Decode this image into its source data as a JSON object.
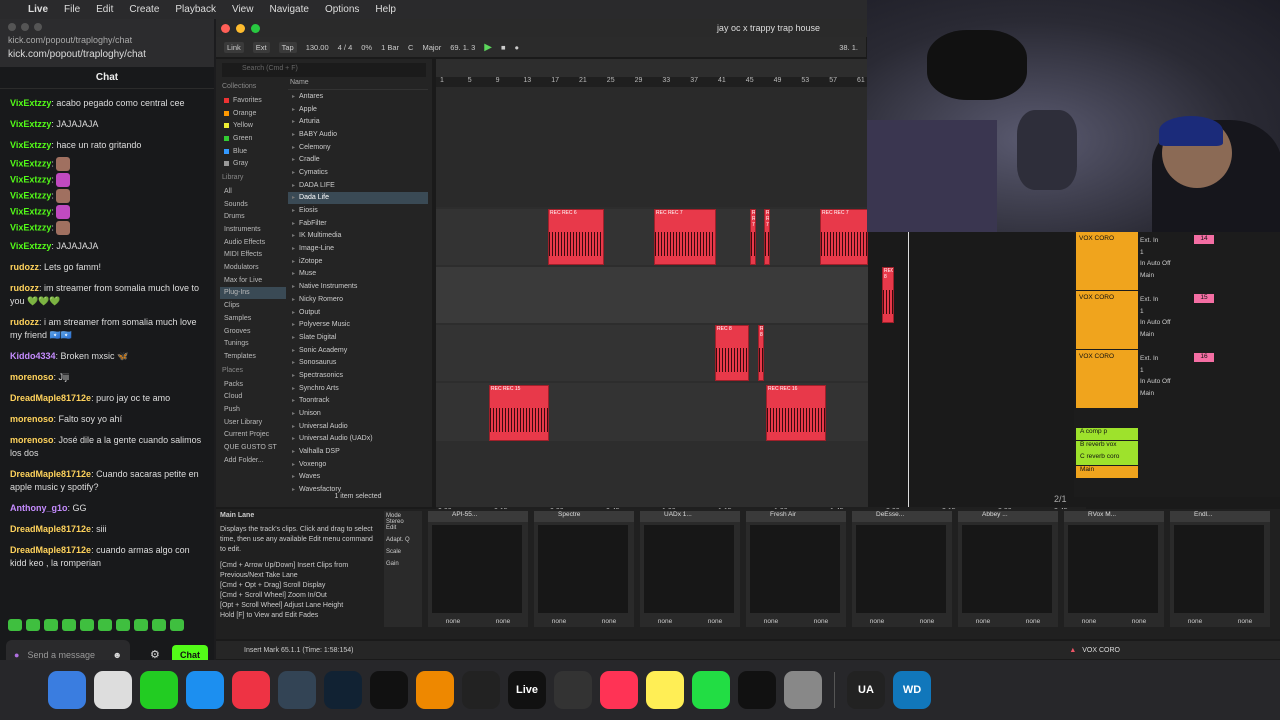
{
  "menubar": {
    "app": "Live",
    "items": [
      "File",
      "Edit",
      "Create",
      "Playback",
      "View",
      "Navigate",
      "Options",
      "Help"
    ]
  },
  "chat": {
    "tab": "kick.com/popout/traploghy/chat",
    "url": "kick.com/popout/traploghy/chat",
    "title": "Chat",
    "messages": [
      {
        "user": "VixExtzzy",
        "color": "#53fc18",
        "text": "acabo pegado como central cee"
      },
      {
        "user": "VixExtzzy",
        "color": "#53fc18",
        "text": "JAJAJAJA"
      },
      {
        "user": "VixExtzzy",
        "color": "#53fc18",
        "text": "hace un rato gritando"
      },
      {
        "user": "VixExtzzy",
        "color": "#53fc18",
        "text": "",
        "emote": "e"
      },
      {
        "user": "VixExtzzy",
        "color": "#53fc18",
        "text": "",
        "emote": "p"
      },
      {
        "user": "VixExtzzy",
        "color": "#53fc18",
        "text": "",
        "emote": "e"
      },
      {
        "user": "VixExtzzy",
        "color": "#53fc18",
        "text": "",
        "emote": "p"
      },
      {
        "user": "VixExtzzy",
        "color": "#53fc18",
        "text": "",
        "emote": "e"
      },
      {
        "user": "VixExtzzy",
        "color": "#53fc18",
        "text": "JAJAJAJA"
      },
      {
        "user": "rudozz",
        "color": "#ffd35c",
        "text": "Lets go famm!"
      },
      {
        "user": "rudozz",
        "color": "#ffd35c",
        "text": "im streamer from somalia much love to you 💚💚💚"
      },
      {
        "user": "rudozz",
        "color": "#ffd35c",
        "text": "i am streamer from somalia much love my friend 🇸🇴🇸🇴"
      },
      {
        "user": "Kiddo4334",
        "color": "#c58cff",
        "text": "Broken mxsic 🦋"
      },
      {
        "user": "morenoso",
        "color": "#ffd35c",
        "text": "Jiji"
      },
      {
        "user": "DreadMaple81712e",
        "color": "#ffd35c",
        "text": "puro jay oc te amo"
      },
      {
        "user": "morenoso",
        "color": "#ffd35c",
        "text": "Falto soy yo ahí"
      },
      {
        "user": "morenoso",
        "color": "#ffd35c",
        "text": "José dile a la gente cuando salimos los dos"
      },
      {
        "user": "DreadMaple81712e",
        "color": "#ffd35c",
        "text": "Cuando sacaras petite en apple music y spotify?"
      },
      {
        "user": "Anthony_g1o",
        "color": "#c58cff",
        "text": "GG"
      },
      {
        "user": "DreadMaple81712e",
        "color": "#ffd35c",
        "text": "siii"
      },
      {
        "user": "DreadMaple81712e",
        "color": "#ffd35c",
        "text": "cuando armas algo con kidd keo , la romperian"
      }
    ],
    "placeholder": "Send a message",
    "send": "Chat"
  },
  "live": {
    "title": "jay oc x trappy trap house",
    "transport": {
      "link": "Link",
      "ext": "Ext",
      "tap": "Tap",
      "bpm": "130.00",
      "sig": "4 / 4",
      "pct": "0%",
      "quant": "1 Bar",
      "key": "C",
      "scale": "Major",
      "pos": "69.  1.  3",
      "end": "38.  1."
    },
    "browser": {
      "search": "Search (Cmd + F)",
      "collections_header": "Collections",
      "collections": [
        {
          "label": "Favorites",
          "color": "#e33"
        },
        {
          "label": "Orange",
          "color": "#f90"
        },
        {
          "label": "Yellow",
          "color": "#ee3"
        },
        {
          "label": "Green",
          "color": "#3c3"
        },
        {
          "label": "Blue",
          "color": "#39f"
        },
        {
          "label": "Gray",
          "color": "#999"
        }
      ],
      "library_header": "Library",
      "library": [
        "All",
        "Sounds",
        "Drums",
        "Instruments",
        "Audio Effects",
        "MIDI Effects",
        "Modulators",
        "Max for Live",
        "Plug-Ins",
        "Clips",
        "Samples",
        "Grooves",
        "Tunings",
        "Templates"
      ],
      "places_header": "Places",
      "places": [
        "Packs",
        "Cloud",
        "Push",
        "User Library",
        "Current Projec",
        "QUE GUSTO ST",
        "Add Folder..."
      ],
      "name_header": "Name",
      "names": [
        "Antares",
        "Apple",
        "Arturia",
        "BABY Audio",
        "Celemony",
        "Cradle",
        "Cymatics",
        "DADA LIFE",
        "Dada Life",
        "Eiosis",
        "FabFilter",
        "IK Multimedia",
        "Image-Line",
        "iZotope",
        "Muse",
        "Native Instruments",
        "Nicky Romero",
        "Output",
        "Polyverse Music",
        "Slate Digital",
        "Sonic Academy",
        "Sonosaurus",
        "Spectrasonics",
        "Synchro Arts",
        "Toontrack",
        "Unison",
        "Universal Audio",
        "Universal Audio (UADx)",
        "Valhalla DSP",
        "Voxengo",
        "Waves",
        "Wavesfactory"
      ],
      "footer": "1 item selected"
    },
    "ruler": [
      "1",
      "5",
      "9",
      "13",
      "17",
      "21",
      "25",
      "29",
      "33",
      "37",
      "41",
      "45",
      "49",
      "53",
      "57",
      "61"
    ],
    "time": [
      "0:00",
      "0:15",
      "0:30",
      "0:45",
      "1:00",
      "1:15",
      "1:30",
      "1:45",
      "2:00",
      "2:15",
      "2:30",
      "2:45"
    ],
    "page": "2/1",
    "tracks": [
      {
        "name": "VOX CORO",
        "num": "14",
        "in": "Ext. In",
        "ch": "1",
        "mon": "In  Auto  Off",
        "out": "Main"
      },
      {
        "name": "VOX CORO",
        "num": "15",
        "in": "Ext. In",
        "ch": "1",
        "mon": "In  Auto  Off",
        "out": "Main"
      },
      {
        "name": "VOX CORO",
        "num": "16",
        "in": "Ext. In",
        "ch": "1",
        "mon": "In  Auto  Off",
        "out": "Main"
      }
    ],
    "returns": [
      {
        "name": "A comp p",
        "color": "#9ee22c"
      },
      {
        "name": "B reverb vox",
        "color": "#9ee22c"
      },
      {
        "name": "C reverb coro",
        "color": "#9ee22c"
      },
      {
        "name": "Main",
        "color": "#f0a41d"
      }
    ],
    "clipnames": [
      "REC REC 6",
      "REC REC 7",
      "REC 8",
      "REC REC 15",
      "REC REC 16"
    ],
    "info": {
      "title": "Main Lane",
      "body": "Displays the track's clips. Click and drag to select time, then use any available Edit menu command to edit.",
      "tips": [
        "[Cmd + Arrow Up/Down] Insert Clips from Previous/Next Take Lane",
        "[Cmd + Opt + Drag] Scroll Display",
        "[Cmd + Scroll Wheel] Zoom In/Out",
        "[Opt + Scroll Wheel] Adjust Lane Height",
        "Hold [F] to View and Edit Fades"
      ]
    },
    "devices": [
      "API-55...",
      "Spectre",
      "UADx 1...",
      "Fresh Air",
      "DeEsse...",
      "Abbey ...",
      "RVox M...",
      "Endl..."
    ],
    "none": "none",
    "status": "Insert Mark 65.1.1 (Time: 1:58:154)",
    "status_track": "VOX CORO"
  },
  "dock": [
    {
      "label": "Finder",
      "color": "#3a7de0"
    },
    {
      "label": "Launchpad",
      "color": "#ddd"
    },
    {
      "label": "FaceTime",
      "color": "#2c2"
    },
    {
      "label": "App Store",
      "color": "#1c8ff0"
    },
    {
      "label": "Chrome",
      "color": "#e34"
    },
    {
      "label": "Xcode",
      "color": "#345"
    },
    {
      "label": "Sonoma",
      "color": "#123"
    },
    {
      "label": "CapCut",
      "color": "#111"
    },
    {
      "label": "FL",
      "color": "#e80"
    },
    {
      "label": "Pen",
      "color": "#222"
    },
    {
      "label": "Live",
      "color": "#111"
    },
    {
      "label": "OBS",
      "color": "#333"
    },
    {
      "label": "Music",
      "color": "#f35"
    },
    {
      "label": "Notes",
      "color": "#fe5"
    },
    {
      "label": "WhatsApp",
      "color": "#2d4"
    },
    {
      "label": "ChatGPT",
      "color": "#111"
    },
    {
      "label": "Settings",
      "color": "#888"
    },
    {
      "label": "UA",
      "color": "#222"
    },
    {
      "label": "WD",
      "color": "#17b"
    }
  ]
}
